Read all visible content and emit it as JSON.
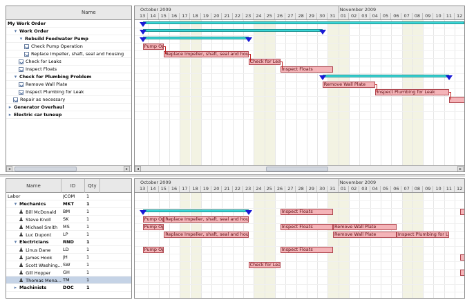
{
  "top_table": {
    "header": "Name",
    "rows": [
      {
        "label": "My Work Order",
        "bold": true,
        "indent": 0,
        "icon": "none"
      },
      {
        "label": "Work Order",
        "bold": true,
        "indent": 1,
        "icon": "expander"
      },
      {
        "label": "Rebuild Feedwater Pump",
        "bold": true,
        "indent": 2,
        "icon": "expander"
      },
      {
        "label": "Check Pump Operation",
        "bold": false,
        "indent": 3,
        "icon": "task"
      },
      {
        "label": "Replace Impeller, shaft, seal and housing",
        "bold": false,
        "indent": 3,
        "icon": "task"
      },
      {
        "label": "Check for Leaks",
        "bold": false,
        "indent": 2,
        "icon": "task"
      },
      {
        "label": "Inspect Floats",
        "bold": false,
        "indent": 2,
        "icon": "task"
      },
      {
        "label": "Check for Plumbing Problem",
        "bold": true,
        "indent": 1,
        "icon": "expander"
      },
      {
        "label": "Remove Wall Plate",
        "bold": false,
        "indent": 2,
        "icon": "task"
      },
      {
        "label": "Inspect Plumbing for Leak",
        "bold": false,
        "indent": 2,
        "icon": "task"
      },
      {
        "label": "Repair as necessary",
        "bold": false,
        "indent": 1,
        "icon": "task"
      },
      {
        "label": "Generator Overhaul",
        "bold": true,
        "indent": 0,
        "icon": "collapsed"
      },
      {
        "label": "Electric car tuneup",
        "bold": true,
        "indent": 0,
        "icon": "collapsed"
      }
    ]
  },
  "bottom_table": {
    "headers": [
      "Name",
      "ID",
      "Qty"
    ],
    "rows": [
      {
        "name": "Labor",
        "id": "JCOM",
        "qty": "1",
        "bold": false,
        "indent": 0,
        "icon": "none",
        "selected": false
      },
      {
        "name": "Mechanics",
        "id": "MKT",
        "qty": "1",
        "bold": true,
        "indent": 1,
        "icon": "expander",
        "selected": false
      },
      {
        "name": "Bill McDonald",
        "id": "BM",
        "qty": "1",
        "bold": false,
        "indent": 2,
        "icon": "person",
        "selected": false
      },
      {
        "name": "Steve Knoll",
        "id": "SK",
        "qty": "1",
        "bold": false,
        "indent": 2,
        "icon": "person",
        "selected": false
      },
      {
        "name": "Michael Smith",
        "id": "MS",
        "qty": "1",
        "bold": false,
        "indent": 2,
        "icon": "person",
        "selected": false
      },
      {
        "name": "Luc Dupont",
        "id": "LP",
        "qty": "1",
        "bold": false,
        "indent": 2,
        "icon": "person",
        "selected": false
      },
      {
        "name": "Electricians",
        "id": "RND",
        "qty": "1",
        "bold": true,
        "indent": 1,
        "icon": "expander",
        "selected": false
      },
      {
        "name": "Linus Dane",
        "id": "LD",
        "qty": "1",
        "bold": false,
        "indent": 2,
        "icon": "person",
        "selected": false
      },
      {
        "name": "James Hook",
        "id": "JH",
        "qty": "1",
        "bold": false,
        "indent": 2,
        "icon": "person",
        "selected": false
      },
      {
        "name": "Scott Washing...",
        "id": "SW",
        "qty": "1",
        "bold": false,
        "indent": 2,
        "icon": "person",
        "selected": false
      },
      {
        "name": "Gill Hopper",
        "id": "GH",
        "qty": "1",
        "bold": false,
        "indent": 2,
        "icon": "person",
        "selected": false
      },
      {
        "name": "Thomas Mona...",
        "id": "TM",
        "qty": "1",
        "bold": false,
        "indent": 2,
        "icon": "person",
        "selected": true
      },
      {
        "name": "Machinists",
        "id": "DOC",
        "qty": "1",
        "bold": true,
        "indent": 1,
        "icon": "collapsed",
        "selected": false
      }
    ]
  },
  "timeline": {
    "month1": "October 2009",
    "month2": "November 2009",
    "days": [
      "13",
      "14",
      "15",
      "16",
      "17",
      "18",
      "19",
      "20",
      "21",
      "22",
      "23",
      "24",
      "25",
      "26",
      "27",
      "28",
      "29",
      "30",
      "31",
      "01",
      "02",
      "03",
      "04",
      "05",
      "06",
      "07",
      "08",
      "09",
      "10",
      "11",
      "12"
    ],
    "weekend_indices": [
      4,
      5,
      11,
      12,
      18,
      19,
      25,
      26
    ]
  },
  "top_gantt": {
    "summaries": [
      {
        "row": 0,
        "start": 0.5,
        "end": 31.5
      },
      {
        "row": 1,
        "start": 0.5,
        "end": 17.5
      },
      {
        "row": 2,
        "start": 0.5,
        "end": 10.5
      },
      {
        "row": 7,
        "start": 17.5,
        "end": 29.5
      }
    ],
    "markers": [
      {
        "row": 0,
        "pos": 0.5
      },
      {
        "row": 1,
        "pos": 0.5
      },
      {
        "row": 1,
        "pos": 17.5
      },
      {
        "row": 2,
        "pos": 0.5
      },
      {
        "row": 2,
        "pos": 10.5
      },
      {
        "row": 7,
        "pos": 17.5
      },
      {
        "row": 7,
        "pos": 29.5
      }
    ],
    "tasks": [
      {
        "row": 3,
        "start": 0.5,
        "end": 2.5,
        "label": "Pump Op"
      },
      {
        "row": 4,
        "start": 2.5,
        "end": 10.5,
        "label": "Replace Impeller, shaft, seal and housing"
      },
      {
        "row": 5,
        "start": 10.5,
        "end": 13.5,
        "label": "Check for Leaks"
      },
      {
        "row": 6,
        "start": 13.5,
        "end": 18.5,
        "label": "Inspect Floats"
      },
      {
        "row": 8,
        "start": 17.5,
        "end": 22.5,
        "label": "Remove Wall Plate"
      },
      {
        "row": 9,
        "start": 22.5,
        "end": 29.5,
        "label": "Inspect Plumbing for Leak"
      },
      {
        "row": 10,
        "start": 29.5,
        "end": 31,
        "label": ""
      }
    ]
  },
  "bottom_gantt": {
    "summaries": [
      {
        "row": 2,
        "start": 0.5,
        "end": 10.5
      }
    ],
    "markers": [
      {
        "row": 2,
        "pos": 0.5
      },
      {
        "row": 2,
        "pos": 10.5
      }
    ],
    "tasks": [
      {
        "row": 2,
        "start": 13.5,
        "end": 18.5,
        "label": "Inspect Floats"
      },
      {
        "row": 2,
        "start": 30.5,
        "end": 31,
        "label": ""
      },
      {
        "row": 3,
        "start": 0.5,
        "end": 2.5,
        "label": "Pump Op"
      },
      {
        "row": 3,
        "start": 2.5,
        "end": 10.5,
        "label": "Replace Impeller, shaft, seal and housing"
      },
      {
        "row": 4,
        "start": 0.5,
        "end": 2.5,
        "label": "Pump Op"
      },
      {
        "row": 4,
        "start": 13.5,
        "end": 18.5,
        "label": "Inspect Floats"
      },
      {
        "row": 4,
        "start": 18.5,
        "end": 24.5,
        "label": "Remove Wall Plate"
      },
      {
        "row": 5,
        "start": 2.5,
        "end": 10.5,
        "label": "Replace Impeller, shaft, seal and housing"
      },
      {
        "row": 5,
        "start": 18.5,
        "end": 24.5,
        "label": "Remove Wall Plate"
      },
      {
        "row": 5,
        "start": 24.5,
        "end": 29.5,
        "label": "Inspect Plumbing for Leak"
      },
      {
        "row": 7,
        "start": 0.5,
        "end": 2.5,
        "label": "Pump Op"
      },
      {
        "row": 7,
        "start": 13.5,
        "end": 18.5,
        "label": "Inspect Floats"
      },
      {
        "row": 8,
        "start": 30.5,
        "end": 31,
        "label": ""
      },
      {
        "row": 9,
        "start": 10.5,
        "end": 13.5,
        "label": "Check for Leaks"
      },
      {
        "row": 10,
        "start": 30.5,
        "end": 31,
        "label": ""
      }
    ]
  }
}
